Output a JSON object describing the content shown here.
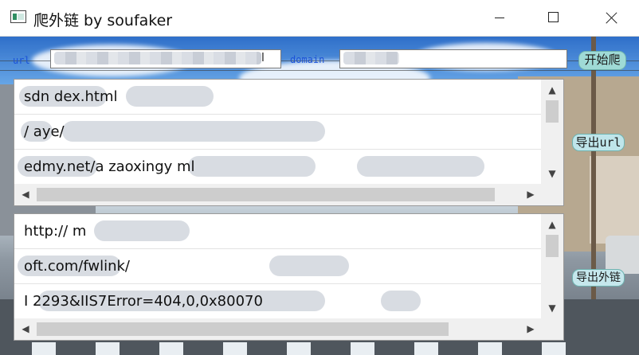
{
  "window": {
    "title": "爬外链  by soufaker",
    "icons": {
      "app": "app-window-icon",
      "minimize": "minimize-icon",
      "maximize": "maximize-icon",
      "close": "close-icon"
    }
  },
  "form": {
    "url_label": "url",
    "url_value": "l",
    "domain_label": "domain",
    "domain_value": ""
  },
  "buttons": {
    "start": "开始爬",
    "export_url": "导出url",
    "export_external": "导出外链"
  },
  "top_list": {
    "rows": [
      "sdn        dex.html",
      "/                                  aye/",
      "edmy.net/a                        zaoxingy                           ml"
    ]
  },
  "bottom_list": {
    "rows": [
      "http://                   m",
      "                oft.com/fwlink/",
      "I                                          2293&IIS7Error=404,0,0x80070"
    ]
  },
  "colors": {
    "label_blue": "#1b52d8",
    "button_teal": "#9fdad6",
    "titlebar": "#ffffff"
  }
}
